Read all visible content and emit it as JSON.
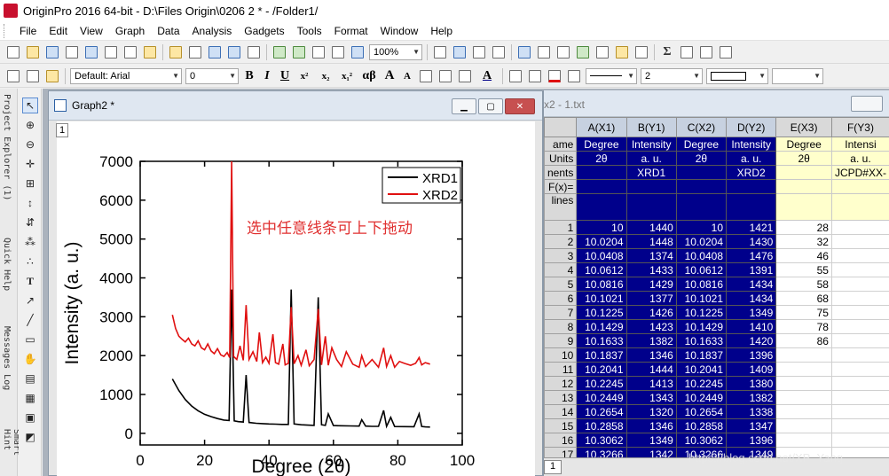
{
  "window": {
    "title": "OriginPro 2016 64-bit - D:\\Files Origin\\0206 2 * - /Folder1/",
    "app_icon": "origin-icon"
  },
  "menu": [
    "File",
    "Edit",
    "View",
    "Graph",
    "Data",
    "Analysis",
    "Gadgets",
    "Tools",
    "Format",
    "Window",
    "Help"
  ],
  "toolbar": {
    "zoom": "100%",
    "font": "Default: Arial",
    "font_size": "0",
    "bold": "B",
    "italic": "I",
    "underline": "U",
    "superscript": "x²",
    "subscript": "x₂",
    "supersub": "x₁²",
    "greek": "αβ",
    "grow_font": "A",
    "shrink_font": "A",
    "text_color": "A",
    "line_width": "2"
  },
  "side_tabs": [
    "Project Explorer (1)",
    "Quick Help",
    "Messages Log",
    "Smart Hint"
  ],
  "graph_window": {
    "title": "Graph2 *",
    "layer": "1"
  },
  "plot": {
    "ylabel": "Intensity (a. u.)",
    "xlabel": "Degree (2θ)",
    "annotation": "选中任意线条可上下拖动",
    "colors": {
      "XRD1": "#000000",
      "XRD2": "#e01010",
      "annotation": "#e03030"
    }
  },
  "chart_data": {
    "type": "line",
    "xlim": [
      0,
      100
    ],
    "ylim": [
      -300,
      7000
    ],
    "xticks": [
      0,
      20,
      40,
      60,
      80,
      100
    ],
    "yticks": [
      0,
      1000,
      2000,
      3000,
      4000,
      5000,
      6000,
      7000
    ],
    "legend_position": "top-right",
    "series": [
      {
        "name": "XRD1",
        "color": "#000000",
        "x": [
          10,
          12,
          14,
          16,
          18,
          20,
          22,
          24,
          26,
          27.6,
          28.4,
          29.2,
          30.5,
          32,
          32.9,
          33.8,
          36,
          38,
          40,
          42,
          44,
          46,
          46.9,
          47.8,
          50,
          52,
          54,
          55.3,
          56.3,
          57.5,
          58.4,
          60,
          62,
          65,
          68,
          68.8,
          70,
          72,
          74,
          75.6,
          76.5,
          77.8,
          79,
          82,
          85,
          86.6,
          87.4,
          88.5,
          90
        ],
        "y": [
          1400,
          1100,
          870,
          700,
          580,
          490,
          430,
          380,
          340,
          330,
          3700,
          320,
          300,
          290,
          1500,
          280,
          260,
          250,
          240,
          235,
          230,
          230,
          3700,
          240,
          220,
          210,
          205,
          3500,
          220,
          205,
          500,
          200,
          195,
          190,
          185,
          350,
          185,
          180,
          178,
          590,
          180,
          410,
          175,
          172,
          170,
          500,
          175,
          165,
          160
        ]
      },
      {
        "name": "XRD2",
        "color": "#e01010",
        "x": [
          10,
          11,
          12,
          13,
          14,
          15,
          16,
          17,
          18,
          19,
          20,
          21,
          22,
          23,
          24,
          25,
          26,
          27,
          27.8,
          28.4,
          29,
          30,
          31,
          32,
          32.9,
          33.8,
          35,
          36.2,
          37,
          38,
          39,
          40,
          41.2,
          42,
          43,
          44.3,
          45,
          46,
          46.9,
          47.8,
          49,
          50,
          51.5,
          52.5,
          54,
          55.3,
          56.3,
          57.5,
          58.4,
          59.5,
          61,
          62.5,
          64,
          66,
          68,
          68.8,
          70,
          72,
          74,
          75.6,
          76.5,
          77.8,
          79,
          80.5,
          82,
          84,
          85.5,
          86.6,
          87.4,
          88.5,
          90
        ],
        "y": [
          3050,
          2700,
          2500,
          2420,
          2350,
          2450,
          2300,
          2250,
          2380,
          2200,
          2150,
          2300,
          2120,
          2050,
          2180,
          2020,
          1980,
          2080,
          1950,
          7000,
          1980,
          1900,
          2250,
          1880,
          3300,
          1900,
          2100,
          1850,
          2600,
          1820,
          1960,
          1800,
          2550,
          1820,
          1780,
          2300,
          1760,
          1800,
          3250,
          1790,
          2000,
          1750,
          2150,
          1740,
          1900,
          3200,
          1760,
          2500,
          1750,
          2200,
          1900,
          1720,
          2100,
          1780,
          1700,
          2000,
          1720,
          1900,
          1700,
          2200,
          1720,
          2000,
          1700,
          1850,
          1800,
          1750,
          1800,
          1950,
          1760,
          1820,
          1780
        ]
      }
    ]
  },
  "worksheet": {
    "title": "x2 - 1.txt",
    "row_labels": [
      "ame",
      "Units",
      "nents",
      "F(x)=",
      "lines"
    ],
    "columns": [
      {
        "header": "A(X1)",
        "name": "Degree",
        "units": "2θ",
        "comment": ""
      },
      {
        "header": "B(Y1)",
        "name": "Intensity",
        "units": "a. u.",
        "comment": "XRD1"
      },
      {
        "header": "C(X2)",
        "name": "Degree",
        "units": "2θ",
        "comment": ""
      },
      {
        "header": "D(Y2)",
        "name": "Intensity",
        "units": "a. u.",
        "comment": "XRD2"
      },
      {
        "header": "E(X3)",
        "name": "Degree",
        "units": "2θ",
        "comment": ""
      },
      {
        "header": "F(Y3)",
        "name": "Intensi",
        "units": "a. u.",
        "comment": "JCPD#XX-"
      }
    ],
    "rows": [
      [
        "1",
        "10",
        "1440",
        "10",
        "1421",
        "28",
        ""
      ],
      [
        "2",
        "10.0204",
        "1448",
        "10.0204",
        "1430",
        "32",
        ""
      ],
      [
        "3",
        "10.0408",
        "1374",
        "10.0408",
        "1476",
        "46",
        ""
      ],
      [
        "4",
        "10.0612",
        "1433",
        "10.0612",
        "1391",
        "55",
        ""
      ],
      [
        "5",
        "10.0816",
        "1429",
        "10.0816",
        "1434",
        "58",
        ""
      ],
      [
        "6",
        "10.1021",
        "1377",
        "10.1021",
        "1434",
        "68",
        ""
      ],
      [
        "7",
        "10.1225",
        "1426",
        "10.1225",
        "1349",
        "75",
        ""
      ],
      [
        "8",
        "10.1429",
        "1423",
        "10.1429",
        "1410",
        "78",
        ""
      ],
      [
        "9",
        "10.1633",
        "1382",
        "10.1633",
        "1420",
        "86",
        ""
      ],
      [
        "10",
        "10.1837",
        "1346",
        "10.1837",
        "1396",
        "",
        ""
      ],
      [
        "11",
        "10.2041",
        "1444",
        "10.2041",
        "1409",
        "",
        ""
      ],
      [
        "12",
        "10.2245",
        "1413",
        "10.2245",
        "1380",
        "",
        ""
      ],
      [
        "13",
        "10.2449",
        "1343",
        "10.2449",
        "1382",
        "",
        ""
      ],
      [
        "14",
        "10.2654",
        "1320",
        "10.2654",
        "1338",
        "",
        ""
      ],
      [
        "15",
        "10.2858",
        "1346",
        "10.2858",
        "1347",
        "",
        ""
      ],
      [
        "16",
        "10.3062",
        "1349",
        "10.3062",
        "1396",
        "",
        ""
      ],
      [
        "17",
        "10.3266",
        "1342",
        "10.3266",
        "1349",
        "",
        ""
      ]
    ],
    "sheet_tab": "1"
  },
  "watermark": "https://blog.csdn.net/XP_Yang"
}
